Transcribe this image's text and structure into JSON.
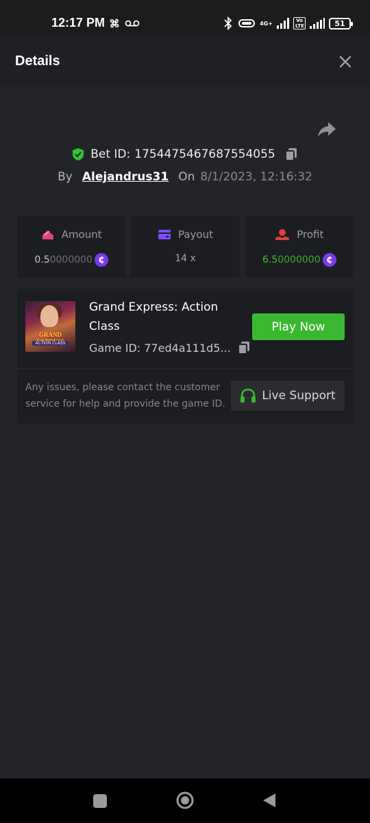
{
  "status_bar": {
    "time": "12:17 PM",
    "network": "4G+",
    "lte": "Vo LTE",
    "battery": "51"
  },
  "header": {
    "title": "Details",
    "close_icon": "close-icon"
  },
  "bet": {
    "id_label": "Bet ID:",
    "id": "1754475467687554055",
    "by_label": "By",
    "username": "Alejandrus31",
    "on_label": "On",
    "date": "8/1/2023, 12:16:32"
  },
  "stats": {
    "amount": {
      "label": "Amount",
      "value_bright": "0.5",
      "value_dim": "0000000",
      "icon": "amount-icon"
    },
    "payout": {
      "label": "Payout",
      "value": "14 x",
      "icon": "wallet-icon"
    },
    "profit": {
      "label": "Profit",
      "value_bright": "6.5",
      "value_dim": "0000000",
      "icon": "profit-icon"
    },
    "coin_symbol": "₵"
  },
  "game": {
    "thumb_title": "GRAND EXPRESS",
    "thumb_subtitle": "ACTION CLASS",
    "title": "Grand Express: Action Class",
    "id_text": "Game ID: 77ed4a111d5...",
    "play_label": "Play Now",
    "help_text": "Any issues, please contact the customer service for help and provide the game ID.",
    "support_label": "Live Support"
  },
  "colors": {
    "accent_green": "#3bb832",
    "coin_purple": "#7c3aed",
    "amount_pink": "#e0447a",
    "payout_purple": "#7c4dff",
    "profit_red": "#e0403a"
  }
}
